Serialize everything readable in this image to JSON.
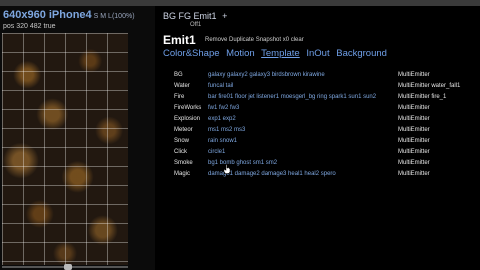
{
  "device": {
    "title": "640x960 iPhone4",
    "sizes": "S M L(100%)",
    "pos": "pos 320 482 true"
  },
  "emitter_panel": {
    "bgfg": "BG FG",
    "emit_label": "Emit1",
    "plus": "+",
    "off": "Off1",
    "title": "Emit1",
    "actions": "Remove Duplicate Snapshot x0 clear"
  },
  "tabs": [
    {
      "label": "Color&Shape",
      "active": false
    },
    {
      "label": "Motion",
      "active": false
    },
    {
      "label": "Template",
      "active": true
    },
    {
      "label": "InOut",
      "active": false
    },
    {
      "label": "Background",
      "active": false
    }
  ],
  "templates": [
    {
      "category": "BG",
      "items": [
        "galaxy galaxy2 galaxy3 birdsbrown kirawine"
      ],
      "emitter": "MultiEmitter"
    },
    {
      "category": "Water",
      "items": [
        "funcal tail"
      ],
      "emitter": "MultiEmitter water_fall1"
    },
    {
      "category": "Fire",
      "items": [
        "bar fire01 floor jet listener1 moesgerl_bg ring spark1 sun1 sun2"
      ],
      "emitter": "MultiEmitter fire_1"
    },
    {
      "category": "FireWorks",
      "items": [
        "fw1 fw2 fw3"
      ],
      "emitter": "MultiEmitter"
    },
    {
      "category": "Explosion",
      "items": [
        "exp1 exp2"
      ],
      "emitter": "MultiEmitter"
    },
    {
      "category": "Meteor",
      "items": [
        "ms1 ms2 ms3"
      ],
      "emitter": "MultiEmitter"
    },
    {
      "category": "Snow",
      "items": [
        "rain snow1"
      ],
      "emitter": "MultiEmitter"
    },
    {
      "category": "Click",
      "items": [
        "circle1"
      ],
      "emitter": "MultiEmitter"
    },
    {
      "category": "Smoke",
      "items": [
        "bg1 bomb ghost sm1 sm2"
      ],
      "emitter": "MultiEmitter"
    },
    {
      "category": "Magic",
      "items": [
        "damage1 damage2 damage3 heal1 heal2 spero"
      ],
      "emitter": "MultiEmitter"
    }
  ],
  "colors": {
    "link": "#7ea7e0",
    "tab": "#6f9fe8",
    "background": "#000000"
  },
  "icons": {
    "cursor": "pointer-hand-icon"
  }
}
